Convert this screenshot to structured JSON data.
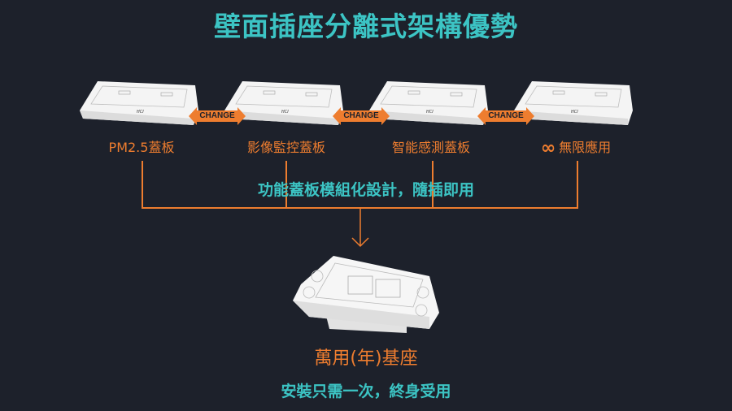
{
  "title": "壁面插座分離式架構優勢",
  "colors": {
    "accent_teal": "#3cc4c4",
    "accent_orange": "#ee7d2f",
    "background": "#1d212b"
  },
  "plates": [
    {
      "label": "PM2.5蓋板",
      "brand": "HCI"
    },
    {
      "label": "影像監控蓋板",
      "brand": "HCI"
    },
    {
      "label": "智能感測蓋板",
      "brand": "HCI"
    },
    {
      "label": "無限應用",
      "brand": "HCI",
      "icon": "infinity-icon",
      "icon_glyph": "∞"
    }
  ],
  "change_label": "CHANGE",
  "modular_text": "功能蓋板模組化設計，隨插即用",
  "base": {
    "title": "萬用(年)基座",
    "subtitle": "安裝只需一次，終身受用"
  }
}
